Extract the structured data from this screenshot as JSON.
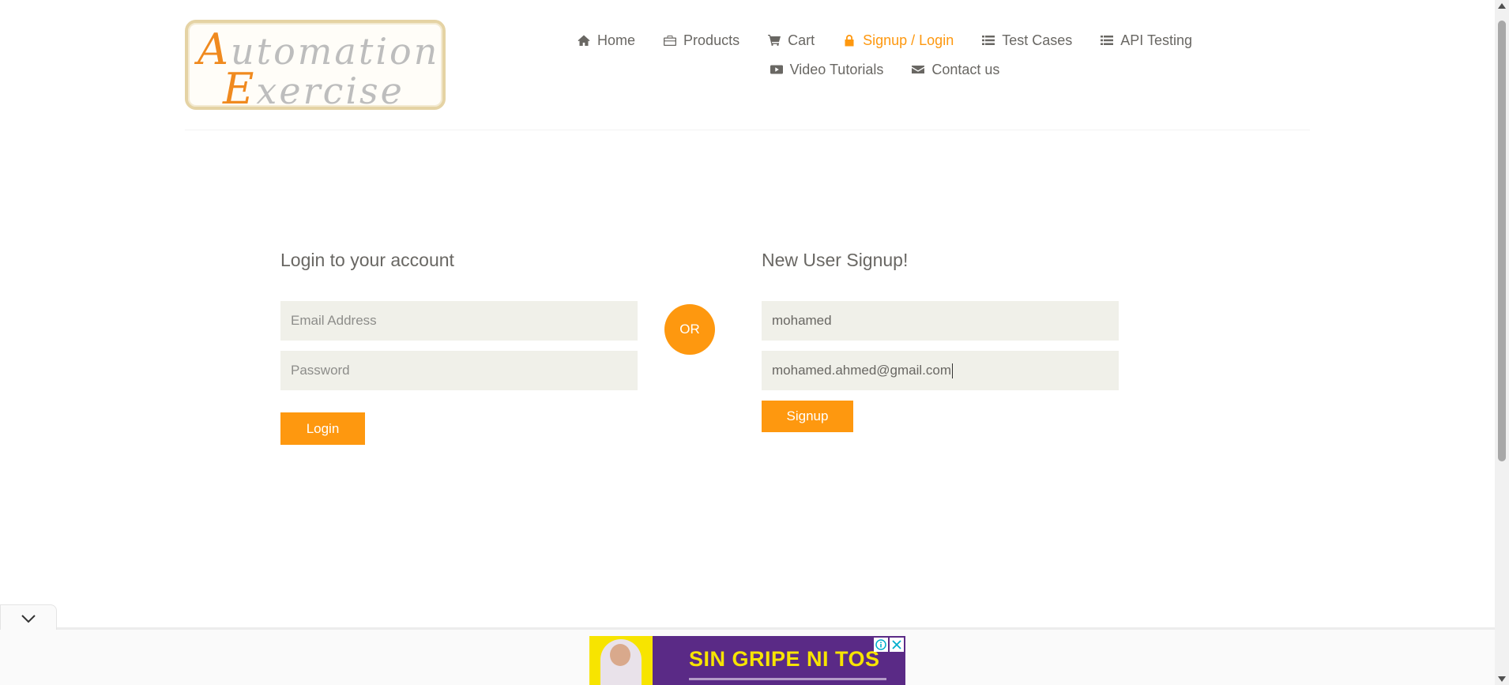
{
  "logo": {
    "line1_cap": "A",
    "line1_rest": "utomation",
    "line2_cap": "E",
    "line2_rest": "xercise"
  },
  "nav": {
    "items": [
      {
        "label": "Home",
        "icon": "home-icon"
      },
      {
        "label": "Products",
        "icon": "briefcase-icon"
      },
      {
        "label": "Cart",
        "icon": "cart-icon"
      },
      {
        "label": "Signup / Login",
        "icon": "lock-icon",
        "active": true
      },
      {
        "label": "Test Cases",
        "icon": "list-icon"
      },
      {
        "label": "API Testing",
        "icon": "list-icon"
      },
      {
        "label": "Video Tutorials",
        "icon": "youtube-icon"
      },
      {
        "label": "Contact us",
        "icon": "envelope-icon"
      }
    ],
    "active_color": "#fe980f"
  },
  "login": {
    "title": "Login to your account",
    "email_placeholder": "Email Address",
    "password_placeholder": "Password",
    "button": "Login"
  },
  "or_label": "OR",
  "signup": {
    "title": "New User Signup!",
    "name_value": "mohamed",
    "email_value": "mohamed.ahmed@gmail.com",
    "button": "Signup"
  },
  "ad": {
    "headline": "SIN GRIPE NI TOS"
  },
  "colors": {
    "accent": "#fe980f",
    "input_bg": "#f0f0e9",
    "text": "#696763"
  }
}
